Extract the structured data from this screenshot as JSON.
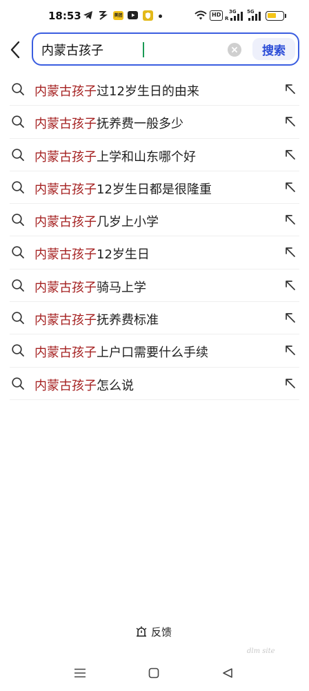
{
  "status_bar": {
    "time": "18:53",
    "app_icons": [
      "telegram-icon",
      "app-icon",
      "meituan-icon",
      "youtube-icon",
      "shield-app-icon"
    ],
    "meituan_label": "美团",
    "hd_label": "HD",
    "net1_label": "3G",
    "net1_sub": "R",
    "net2_label": "5G",
    "battery_level": 0.55,
    "battery_color": "#f5c518"
  },
  "search": {
    "query": "内蒙古孩子",
    "button_label": "搜索",
    "accent_color": "#3a5de0",
    "keyword_color": "#a52121"
  },
  "suggestions": [
    {
      "keyword": "内蒙古孩子",
      "rest": "过12岁生日的由来"
    },
    {
      "keyword": "内蒙古孩子",
      "rest": "抚养费一般多少"
    },
    {
      "keyword": "内蒙古孩子",
      "rest": "上学和山东哪个好"
    },
    {
      "keyword": "内蒙古孩子",
      "rest": "12岁生日都是很隆重"
    },
    {
      "keyword": "内蒙古孩子",
      "rest": "几岁上小学"
    },
    {
      "keyword": "内蒙古孩子",
      "rest": "12岁生日"
    },
    {
      "keyword": "内蒙古孩子",
      "rest": "骑马上学"
    },
    {
      "keyword": "内蒙古孩子",
      "rest": "抚养费标准"
    },
    {
      "keyword": "内蒙古孩子",
      "rest": "上户口需要什么手续"
    },
    {
      "keyword": "内蒙古孩子",
      "rest": "怎么说"
    }
  ],
  "feedback": {
    "label": "反馈"
  },
  "watermark": "dlm site",
  "nav": {
    "buttons": [
      "menu-icon",
      "home-square-icon",
      "back-triangle-icon"
    ]
  }
}
